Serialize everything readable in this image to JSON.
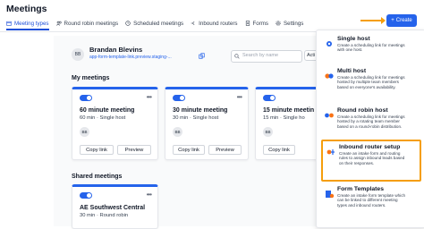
{
  "header": {
    "title": "Meetings",
    "create_label": "Create"
  },
  "tabs": [
    {
      "label": "Meeting types",
      "icon": "calendar-icon",
      "active": true
    },
    {
      "label": "Round robin meetings",
      "icon": "people-icon"
    },
    {
      "label": "Scheduled meetings",
      "icon": "clock-icon"
    },
    {
      "label": "Inbound routers",
      "icon": "routing-icon"
    },
    {
      "label": "Forms",
      "icon": "form-icon"
    },
    {
      "label": "Settings",
      "icon": "gear-icon"
    }
  ],
  "user": {
    "initials": "BB",
    "name": "Brandan Blevins",
    "link": "app-form-template-link.preview.staging-..."
  },
  "search": {
    "placeholder": "Search by name"
  },
  "actions_label": "Acti",
  "my_meetings": {
    "label": "My meetings",
    "cards": [
      {
        "title": "60 minute meeting",
        "subtitle": "60 min · Single host",
        "initials": "BB",
        "copy_label": "Copy link",
        "preview_label": "Preview"
      },
      {
        "title": "30 minute meeting",
        "subtitle": "30 min · Single host",
        "initials": "BB",
        "copy_label": "Copy link",
        "preview_label": "Preview"
      },
      {
        "title": "15 minute meetin",
        "subtitle": "15 min · Single ho",
        "initials": "BB",
        "copy_label": "Copy link"
      }
    ]
  },
  "shared_meetings": {
    "label": "Shared meetings",
    "cards": [
      {
        "title": "AE Southwest Central",
        "subtitle": "30 min · Round robin"
      }
    ]
  },
  "dropdown": {
    "items": [
      {
        "title": "Single host",
        "desc": [
          "Create a scheduling link for meetings",
          "with one host."
        ]
      },
      {
        "title": "Multi host",
        "desc": [
          "Create a scheduling link for meetings",
          "hosted by multiple team members",
          "based on everyone's availability."
        ]
      },
      {
        "title": "Round robin host",
        "desc": [
          "Create a scheduling link for meetings",
          "hosted by a rotating team member",
          "based on a round-robin distribution."
        ]
      },
      {
        "title": "Inbound router setup",
        "desc": [
          "Create an intake form and routing",
          "rules to assign inbound leads based",
          "on their responses."
        ],
        "highlight": true
      },
      {
        "title": "Form Templates",
        "desc": [
          "Create an intake form template which",
          "can be linked to different meeting",
          "types and inbound routers."
        ]
      }
    ]
  },
  "colors": {
    "accent": "#2563eb",
    "highlight": "#f59e0b"
  }
}
